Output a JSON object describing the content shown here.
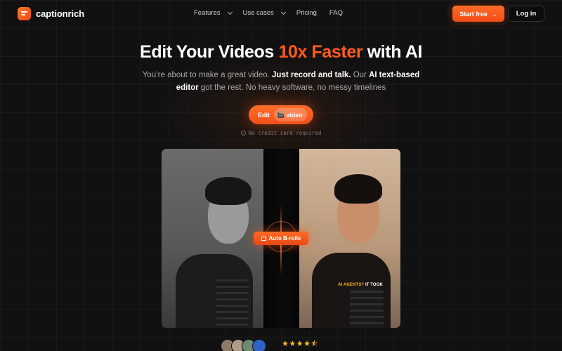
{
  "nav": {
    "logo_text": "captionrich",
    "menu": [
      {
        "label": "Features",
        "dropdown": true
      },
      {
        "label": "Use cases",
        "dropdown": true
      },
      {
        "label": "Pricing",
        "dropdown": false
      },
      {
        "label": "FAQ",
        "dropdown": false
      }
    ],
    "start_label": "Start free",
    "start_icon": "→",
    "login_label": "Log in"
  },
  "hero": {
    "headline_pre": "Edit Your Videos ",
    "headline_accent": "10x Faster",
    "headline_post": " with AI",
    "sub_1": "You’re about to make a great video. ",
    "sub_bold_1": "Just record and talk.",
    "sub_2": " Our ",
    "sub_bold_2": "AI text-based editor",
    "sub_3": " got the rest. No heavy software, no messy timelines",
    "cta_label": "Edit",
    "cta_chip_icon": "🎬",
    "cta_chip_label": "video",
    "no_card": "No credit card required"
  },
  "video": {
    "badge_label": "Auto B-rolls",
    "caption_hl": "AI AGENTS?",
    "caption_rest": " IT TOOK"
  },
  "social": {
    "stars": "★★★★⯪"
  },
  "colors": {
    "accent": "#ff5a1e",
    "background": "#111111",
    "star": "#ffc21a"
  }
}
